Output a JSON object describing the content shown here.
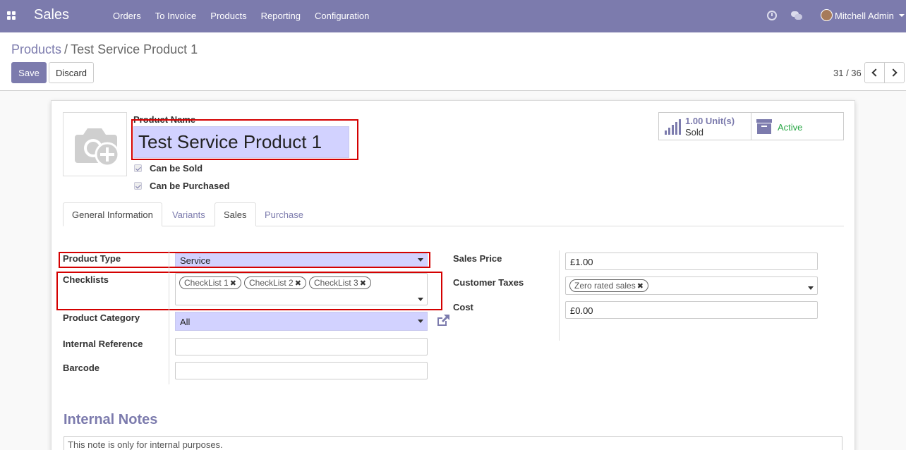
{
  "navbar": {
    "app_name": "Sales",
    "menu": [
      "Orders",
      "To Invoice",
      "Products",
      "Reporting",
      "Configuration"
    ],
    "user_name": "Mitchell Admin",
    "bg_color": "#7c7bad"
  },
  "breadcrumb": {
    "parent": "Products",
    "separator": "/",
    "current": "Test Service Product 1"
  },
  "toolbar": {
    "save_label": "Save",
    "discard_label": "Discard"
  },
  "pager": {
    "value": "31 / 36"
  },
  "product": {
    "name_label": "Product Name",
    "name": "Test Service Product 1",
    "can_be_sold_label": "Can be Sold",
    "can_be_purchased_label": "Can be Purchased"
  },
  "stats": {
    "sold_value": "1.00 Unit(s)",
    "sold_label": "Sold",
    "active_label": "Active"
  },
  "tabs": [
    "General Information",
    "Variants",
    "Sales",
    "Purchase"
  ],
  "general": {
    "product_type_label": "Product Type",
    "product_type": "Service",
    "checklists_label": "Checklists",
    "checklists": [
      "CheckList 1",
      "CheckList 2",
      "CheckList 3"
    ],
    "category_label": "Product Category",
    "category": "All",
    "internal_ref_label": "Internal Reference",
    "internal_ref": "",
    "barcode_label": "Barcode",
    "barcode": "",
    "sales_price_label": "Sales Price",
    "sales_price": "£1.00",
    "customer_taxes_label": "Customer Taxes",
    "customer_taxes": [
      "Zero rated sales"
    ],
    "cost_label": "Cost",
    "cost": "£0.00"
  },
  "notes": {
    "title": "Internal Notes",
    "placeholder": "This note is only for internal purposes."
  }
}
